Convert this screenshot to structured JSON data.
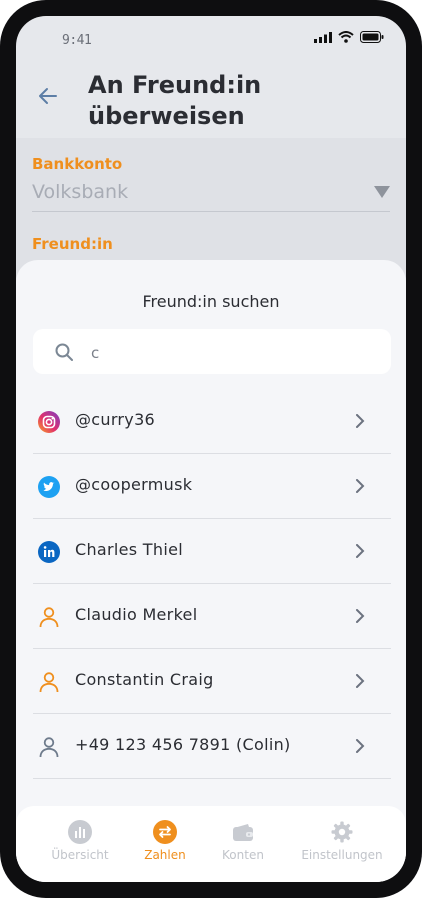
{
  "status_bar": {
    "time": "9:41"
  },
  "header": {
    "title": "An Freund:in überweisen"
  },
  "form": {
    "bank_label": "Bankkonto",
    "bank_value": "Volksbank",
    "friend_label": "Freund:in"
  },
  "sheet": {
    "title": "Freund:in suchen",
    "search_value": "c",
    "contacts": [
      {
        "name": "@curry36",
        "icon": "instagram-icon"
      },
      {
        "name": "@coopermusk",
        "icon": "twitter-icon"
      },
      {
        "name": "Charles Thiel",
        "icon": "linkedin-icon"
      },
      {
        "name": "Claudio Merkel",
        "icon": "person-icon"
      },
      {
        "name": "Constantin Craig",
        "icon": "person-icon"
      },
      {
        "name": "+49 123 456 7891 (Colin)",
        "icon": "person-icon"
      }
    ]
  },
  "tabbar": {
    "tabs": [
      {
        "label": "Übersicht",
        "icon": "chart-icon",
        "active": false
      },
      {
        "label": "Zahlen",
        "icon": "transfer-icon",
        "active": true
      },
      {
        "label": "Konten",
        "icon": "wallet-icon",
        "active": false
      },
      {
        "label": "Einstellungen",
        "icon": "gear-icon",
        "active": false
      }
    ]
  },
  "colors": {
    "accent": "#ef8f1e",
    "text": "#2b2d33",
    "muted": "#a8acb5"
  }
}
